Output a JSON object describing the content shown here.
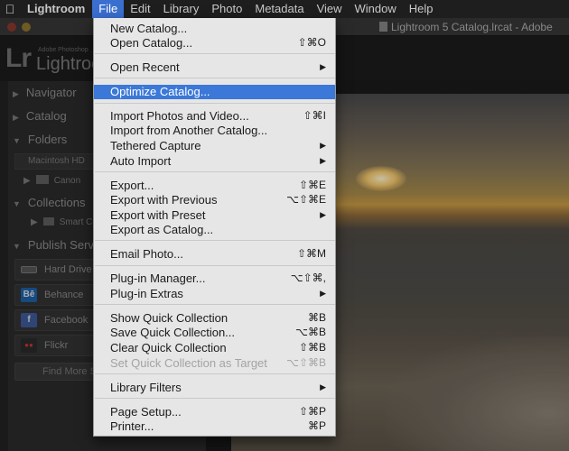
{
  "menubar": {
    "apple": "",
    "items": [
      "Lightroom",
      "File",
      "Edit",
      "Library",
      "Photo",
      "Metadata",
      "View",
      "Window",
      "Help"
    ],
    "active": "File"
  },
  "window": {
    "title": "Lightroom 5 Catalog.lrcat - Adobe"
  },
  "identity": {
    "logo": "Lr",
    "brand_small": "Adobe Photoshop",
    "brand_name": "Lightroom"
  },
  "left_panel": {
    "sections": {
      "navigator": "Navigator",
      "catalog": "Catalog",
      "folders": "Folders",
      "collections": "Collections",
      "publish": "Publish Services"
    },
    "volume": "Macintosh HD",
    "folder": "Canon",
    "smart_collection": "Smart Collections",
    "services": [
      {
        "label": "Hard Drive",
        "icon": "hard-drive-icon",
        "icon_text": "",
        "color": "#555555"
      },
      {
        "label": "Behance",
        "icon": "behance-icon",
        "icon_text": "Bē",
        "color": "#1b5fa8"
      },
      {
        "label": "Facebook",
        "icon": "facebook-icon",
        "icon_text": "f",
        "color": "#3b5998"
      },
      {
        "label": "Flickr",
        "icon": "flickr-icon",
        "icon_text": "●●",
        "color": "#2a2a2a"
      }
    ],
    "find_more": "Find More Services Online"
  },
  "file_menu": {
    "items": [
      {
        "label": "New Catalog...",
        "shortcut": ""
      },
      {
        "label": "Open Catalog...",
        "shortcut": "⇧⌘O"
      },
      {
        "label": "Open Recent",
        "shortcut": "▶"
      },
      {
        "label": "Optimize Catalog...",
        "shortcut": ""
      },
      {
        "label": "Import Photos and Video...",
        "shortcut": "⇧⌘I"
      },
      {
        "label": "Import from Another Catalog...",
        "shortcut": ""
      },
      {
        "label": "Tethered Capture",
        "shortcut": "▶"
      },
      {
        "label": "Auto Import",
        "shortcut": "▶"
      },
      {
        "label": "Export...",
        "shortcut": "⇧⌘E"
      },
      {
        "label": "Export with Previous",
        "shortcut": "⌥⇧⌘E"
      },
      {
        "label": "Export with Preset",
        "shortcut": "▶"
      },
      {
        "label": "Export as Catalog...",
        "shortcut": ""
      },
      {
        "label": "Email Photo...",
        "shortcut": "⇧⌘M"
      },
      {
        "label": "Plug-in Manager...",
        "shortcut": "⌥⇧⌘,"
      },
      {
        "label": "Plug-in Extras",
        "shortcut": "▶"
      },
      {
        "label": "Show Quick Collection",
        "shortcut": "⌘B"
      },
      {
        "label": "Save Quick Collection...",
        "shortcut": "⌥⌘B"
      },
      {
        "label": "Clear Quick Collection",
        "shortcut": "⇧⌘B"
      },
      {
        "label": "Set Quick Collection as Target",
        "shortcut": "⌥⇧⌘B"
      },
      {
        "label": "Library Filters",
        "shortcut": "▶"
      },
      {
        "label": "Page Setup...",
        "shortcut": "⇧⌘P"
      },
      {
        "label": "Printer...",
        "shortcut": "⌘P"
      }
    ],
    "highlighted_index": 3,
    "disabled_index": 18
  },
  "colors": {
    "menu_highlight": "#3b78d8",
    "menubar_active": "#3a6fd0"
  }
}
